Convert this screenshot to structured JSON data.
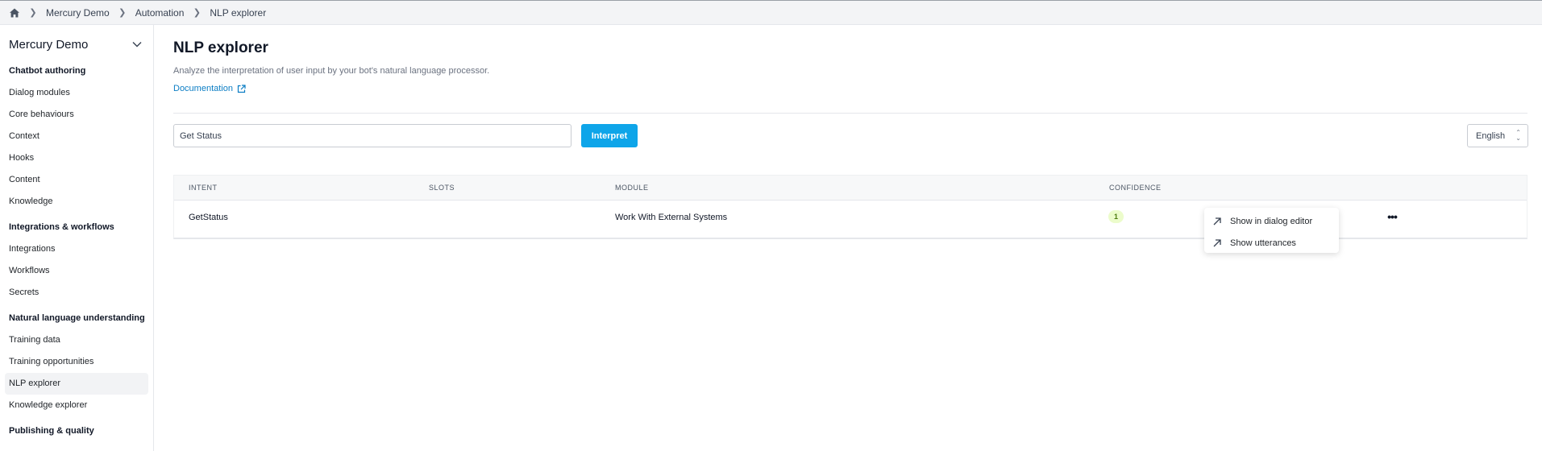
{
  "breadcrumb": {
    "home_icon": "home-icon",
    "items": [
      "Mercury Demo",
      "Automation",
      "NLP explorer"
    ]
  },
  "sidebar": {
    "workspace": "Mercury Demo",
    "sections": [
      {
        "title": "Chatbot authoring",
        "items": [
          "Dialog modules",
          "Core behaviours",
          "Context",
          "Hooks",
          "Content",
          "Knowledge"
        ]
      },
      {
        "title": "Integrations & workflows",
        "items": [
          "Integrations",
          "Workflows",
          "Secrets"
        ]
      },
      {
        "title": "Natural language understanding",
        "items": [
          "Training data",
          "Training opportunities",
          "NLP explorer",
          "Knowledge explorer"
        ]
      },
      {
        "title": "Publishing & quality",
        "items": []
      }
    ],
    "active_item": "NLP explorer"
  },
  "main": {
    "title": "NLP explorer",
    "description": "Analyze the interpretation of user input by your bot's natural language processor.",
    "doc_link": "Documentation",
    "query": {
      "value": "Get Status",
      "button": "Interpret"
    },
    "language": "English",
    "table": {
      "columns": [
        "INTENT",
        "SLOTS",
        "MODULE",
        "CONFIDENCE"
      ],
      "rows": [
        {
          "intent": "GetStatus",
          "slots": "",
          "module": "Work With External Systems",
          "confidence": "1"
        }
      ]
    },
    "row_menu": [
      "Show in dialog editor",
      "Show utterances"
    ]
  },
  "colors": {
    "accent": "#0ea5e9",
    "link": "#0b7dc4",
    "badge_bg": "#ecfccb",
    "badge_text": "#4d7c0f"
  }
}
